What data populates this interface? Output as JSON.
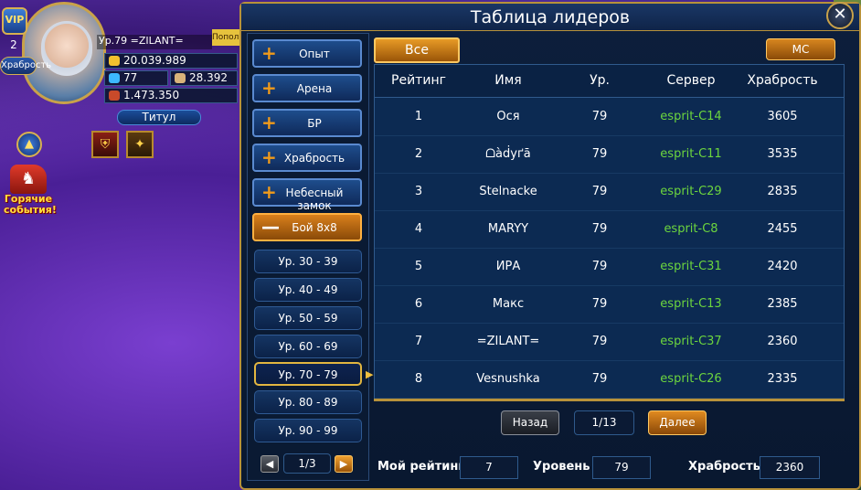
{
  "hud": {
    "vip_label": "VIP",
    "vip_level": "2",
    "bravery_tag": "Храбрость",
    "player_line": "Ур.79    =ZILANT=",
    "popup_label": "Попол",
    "gold": "20.039.989",
    "diamonds": "77",
    "scrolls": "28.392",
    "power": "1.473.350",
    "title_button": "Титул",
    "hot_events": "Горячие события!"
  },
  "panel": {
    "title": "Таблица лидеров",
    "categories": [
      {
        "label": "Опыт",
        "open": false
      },
      {
        "label": "Арена",
        "open": false
      },
      {
        "label": "БР",
        "open": false
      },
      {
        "label": "Храбрость",
        "open": false
      },
      {
        "label": "Небесный замок",
        "open": false
      },
      {
        "label": "Бой 8х8",
        "open": true
      }
    ],
    "levels": [
      "Ур. 30 - 39",
      "Ур. 40 - 49",
      "Ур. 50 - 59",
      "Ур. 60 - 69",
      "Ур. 70 - 79",
      "Ур. 80 - 89",
      "Ур. 90 - 99"
    ],
    "active_level": "Ур. 70 - 79",
    "level_page": "1/3",
    "tab_all": "Все",
    "tab_mc": "МС",
    "columns": [
      "Рейтинг",
      "Имя",
      "Ур.",
      "Сервер",
      "Храбрость"
    ],
    "rows": [
      {
        "rank": "1",
        "name": "Ося",
        "lvl": "79",
        "server": "esprit-C14",
        "bravery": "3605"
      },
      {
        "rank": "2",
        "name": "ᗝàḋуґā",
        "lvl": "79",
        "server": "esprit-C11",
        "bravery": "3535"
      },
      {
        "rank": "3",
        "name": "Stelnacke",
        "lvl": "79",
        "server": "esprit-C29",
        "bravery": "2835"
      },
      {
        "rank": "4",
        "name": "MARYY",
        "lvl": "79",
        "server": "esprit-C8",
        "bravery": "2455"
      },
      {
        "rank": "5",
        "name": "ИРА",
        "lvl": "79",
        "server": "esprit-C31",
        "bravery": "2420"
      },
      {
        "rank": "6",
        "name": "Макс",
        "lvl": "79",
        "server": "esprit-C13",
        "bravery": "2385"
      },
      {
        "rank": "7",
        "name": "=ZILANT=",
        "lvl": "79",
        "server": "esprit-C37",
        "bravery": "2360"
      },
      {
        "rank": "8",
        "name": "Vesnushka",
        "lvl": "79",
        "server": "esprit-C26",
        "bravery": "2335"
      }
    ],
    "back_label": "Назад",
    "page": "1/13",
    "next_label": "Далее",
    "my_rank_label": "Мой рейтинг",
    "my_rank": "7",
    "level_label": "Уровень",
    "my_level": "79",
    "bravery_label": "Храбрость",
    "my_bravery": "2360"
  }
}
